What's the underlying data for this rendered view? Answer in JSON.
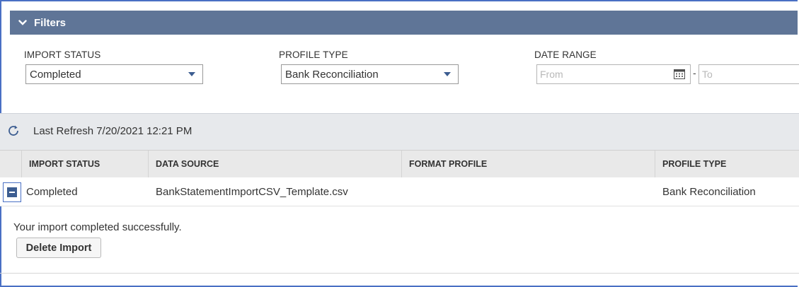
{
  "filters": {
    "title": "Filters",
    "import_status": {
      "label": "IMPORT STATUS",
      "value": "Completed"
    },
    "profile_type": {
      "label": "PROFILE TYPE",
      "value": "Bank Reconciliation"
    },
    "date_range": {
      "label": "DATE RANGE",
      "from_placeholder": "From",
      "to_placeholder": "To",
      "separator": "-"
    }
  },
  "refresh": {
    "text": "Last Refresh 7/20/2021 12:21 PM"
  },
  "table": {
    "columns": [
      "IMPORT STATUS",
      "DATA SOURCE",
      "FORMAT PROFILE",
      "PROFILE TYPE"
    ],
    "rows": [
      {
        "import_status": "Completed",
        "data_source": "BankStatementImportCSV_Template.csv",
        "format_profile": "",
        "profile_type": "Bank Reconciliation"
      }
    ]
  },
  "detail": {
    "message": "Your import completed successfully.",
    "delete_label": "Delete Import"
  },
  "colors": {
    "header_bar": "#5f7597",
    "accent": "#3c5d91",
    "frame_border": "#4a70c4"
  }
}
